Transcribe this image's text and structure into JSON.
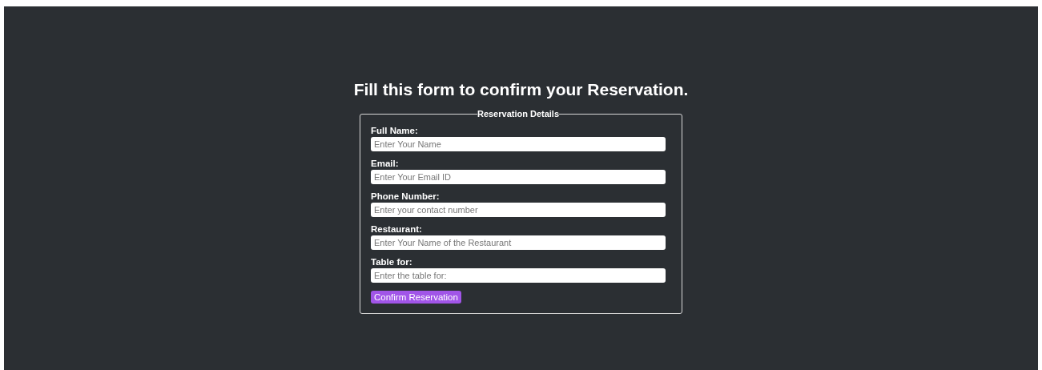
{
  "heading": "Fill this form to confirm your Reservation.",
  "form": {
    "legend": "Reservation Details",
    "fields": [
      {
        "label": "Full Name:",
        "placeholder": "Enter Your Name"
      },
      {
        "label": "Email:",
        "placeholder": "Enter Your Email ID"
      },
      {
        "label": "Phone Number:",
        "placeholder": "Enter your contact number"
      },
      {
        "label": "Restaurant:",
        "placeholder": "Enter Your Name of the Restaurant"
      },
      {
        "label": "Table for:",
        "placeholder": "Enter the table for:"
      }
    ],
    "submit": "Confirm Reservation"
  }
}
